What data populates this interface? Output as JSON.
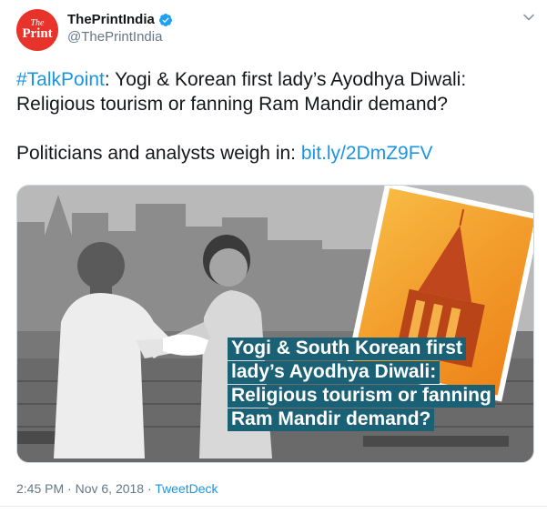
{
  "account": {
    "display_name": "ThePrintIndia",
    "handle": "@ThePrintIndia",
    "avatar_line1": "The",
    "avatar_line2": "Print"
  },
  "tweet": {
    "hashtag": "#TalkPoint",
    "line1_rest": ": Yogi & Korean first lady’s Ayodhya Diwali:",
    "line2": "Religious tourism or fanning Ram Mandir demand?",
    "line3_prefix": "Politicians and analysts weigh in: ",
    "link": "bit.ly/2DmZ9FV"
  },
  "image": {
    "caption_lines": [
      "Yogi & South Korean first",
      "lady’s Ayodhya Diwali:",
      "Religious tourism or fanning",
      "Ram Mandir demand?"
    ]
  },
  "meta": {
    "time": "2:45 PM",
    "date": "Nov 6, 2018",
    "separator": "·",
    "client": "TweetDeck"
  },
  "colors": {
    "link": "#1b95e0",
    "caption_bg": "#1b6176",
    "avatar_bg": "#e8332a",
    "verified": "#1da1f2"
  },
  "icons": {
    "verified": "verified-badge-icon",
    "more": "chevron-down-icon"
  }
}
